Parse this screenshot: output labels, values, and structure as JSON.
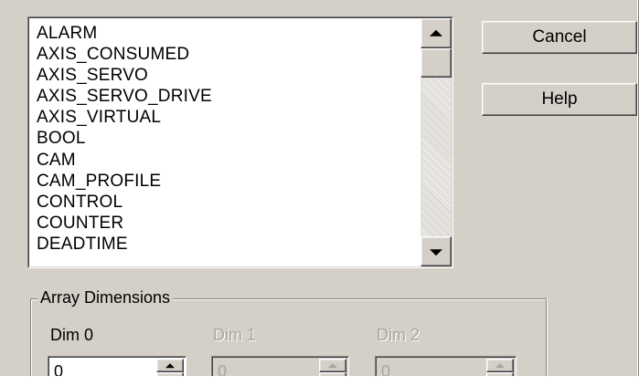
{
  "types_list": {
    "items": [
      "ALARM",
      "AXIS_CONSUMED",
      "AXIS_SERVO",
      "AXIS_SERVO_DRIVE",
      "AXIS_VIRTUAL",
      "BOOL",
      "CAM",
      "CAM_PROFILE",
      "CONTROL",
      "COUNTER",
      "DEADTIME"
    ],
    "scrollbar": {
      "up_icon": "triangle-up-icon",
      "down_icon": "triangle-down-icon"
    }
  },
  "buttons": {
    "cancel_label": "Cancel",
    "help_label": "Help"
  },
  "array_dimensions": {
    "title": "Array Dimensions",
    "dims": [
      {
        "label": "Dim 0",
        "value": "0",
        "enabled": true
      },
      {
        "label": "Dim 1",
        "value": "0",
        "enabled": false
      },
      {
        "label": "Dim 2",
        "value": "0",
        "enabled": false
      }
    ]
  },
  "colors": {
    "dialog_bg": "#d4d0c8",
    "list_bg": "#ffffff",
    "disabled_text": "#a8a59f"
  }
}
